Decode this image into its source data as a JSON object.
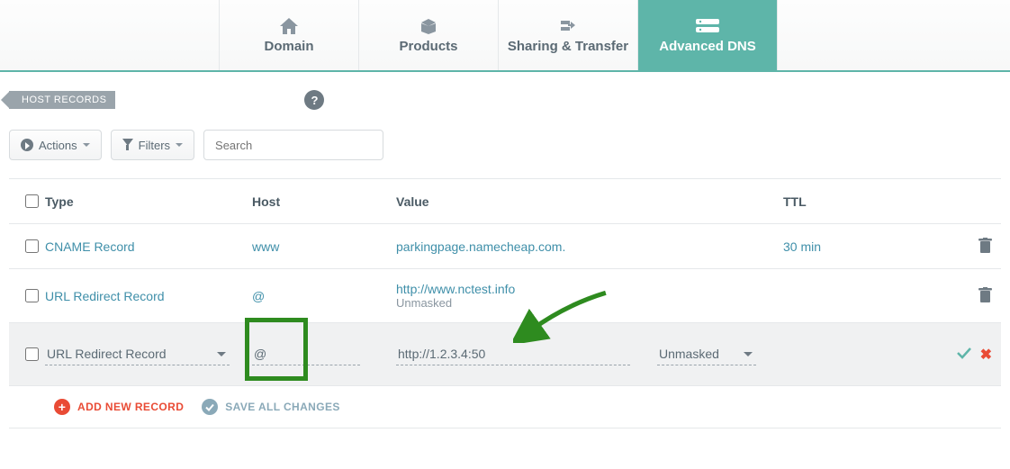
{
  "tabs": [
    {
      "label": "Domain",
      "icon": "home"
    },
    {
      "label": "Products",
      "icon": "box"
    },
    {
      "label": "Sharing & Transfer",
      "icon": "share"
    },
    {
      "label": "Advanced DNS",
      "icon": "server",
      "active": true
    }
  ],
  "section_tag": "HOST RECORDS",
  "toolbar": {
    "actions_label": "Actions",
    "filters_label": "Filters",
    "search_placeholder": "Search"
  },
  "columns": {
    "type": "Type",
    "host": "Host",
    "value": "Value",
    "ttl": "TTL"
  },
  "rows": [
    {
      "type": "CNAME Record",
      "host": "www",
      "value": "parkingpage.namecheap.com.",
      "value2": "",
      "ttl": "30 min"
    },
    {
      "type": "URL Redirect Record",
      "host": "@",
      "value": "http://www.nctest.info",
      "value2": "Unmasked",
      "ttl": ""
    }
  ],
  "edit_row": {
    "type": "URL Redirect Record",
    "host": "@",
    "value": "http://1.2.3.4:50",
    "mask": "Unmasked"
  },
  "footer": {
    "add": "ADD NEW RECORD",
    "save": "SAVE ALL CHANGES"
  }
}
